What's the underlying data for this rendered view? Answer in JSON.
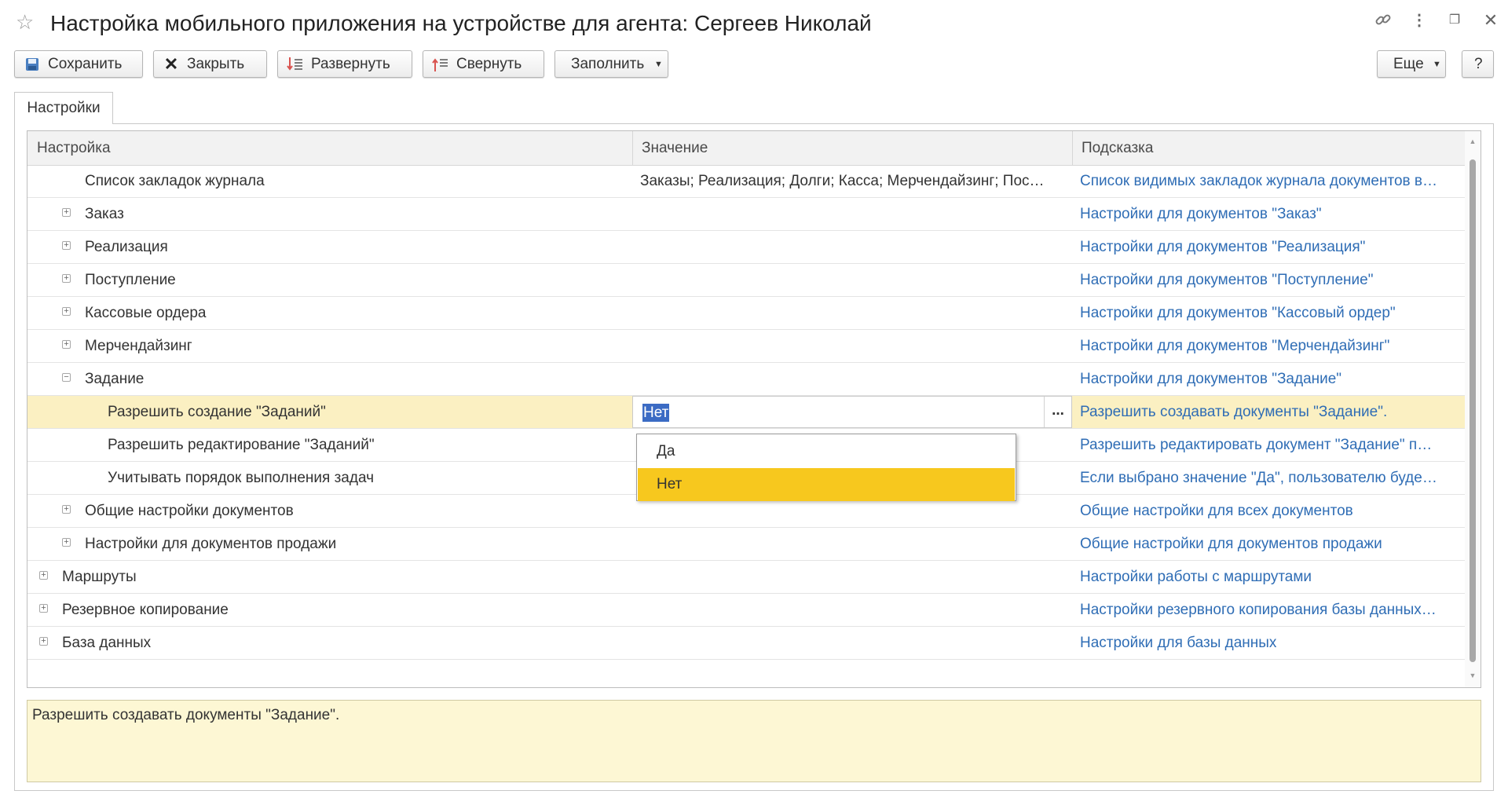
{
  "window": {
    "title": "Настройка мобильного приложения на устройстве для агента: Сергеев Николай",
    "controls": {
      "favorite_icon": "☆",
      "link_icon": "🔗",
      "more_icon": "⋮",
      "restore_icon": "❐",
      "close_icon": "✕"
    }
  },
  "toolbar": {
    "save_label": "Сохранить",
    "close_label": "Закрыть",
    "expand_label": "Развернуть",
    "collapse_label": "Свернуть",
    "fill_label": "Заполнить",
    "more_label": "Еще",
    "help_label": "?"
  },
  "tabs": [
    {
      "label": "Настройки",
      "active": true
    }
  ],
  "grid": {
    "columns": [
      "Настройка",
      "Значение",
      "Подсказка"
    ],
    "rows": [
      {
        "name": "Список закладок журнала",
        "value": "Заказы; Реализация; Долги; Касса; Мерчендайзинг; Пос…",
        "hint": "Список видимых закладок журнала документов в…",
        "toggle": "",
        "level": 1
      },
      {
        "name": "Заказ",
        "value": "",
        "hint": "Настройки для документов \"Заказ\"",
        "toggle": "+",
        "level": 1
      },
      {
        "name": "Реализация",
        "value": "",
        "hint": "Настройки для документов \"Реализация\"",
        "toggle": "+",
        "level": 1
      },
      {
        "name": "Поступление",
        "value": "",
        "hint": "Настройки для документов \"Поступление\"",
        "toggle": "+",
        "level": 1
      },
      {
        "name": "Кассовые ордера",
        "value": "",
        "hint": "Настройки для документов \"Кассовый ордер\"",
        "toggle": "+",
        "level": 1
      },
      {
        "name": "Мерчендайзинг",
        "value": "",
        "hint": "Настройки для документов \"Мерчендайзинг\"",
        "toggle": "+",
        "level": 1
      },
      {
        "name": "Задание",
        "value": "",
        "hint": "Настройки для документов \"Задание\"",
        "toggle": "−",
        "level": 1
      },
      {
        "name": "Разрешить создание \"Заданий\"",
        "value": "Нет",
        "hint": "Разрешить создавать документы \"Задание\".",
        "toggle": "",
        "level": 2,
        "selected": true
      },
      {
        "name": "Разрешить редактирование \"Заданий\"",
        "value": "",
        "hint": "Разрешить редактировать документ \"Задание\" п…",
        "toggle": "",
        "level": 2
      },
      {
        "name": "Учитывать порядок выполнения задач",
        "value": "",
        "hint": "Если выбрано значение \"Да\", пользователю буде…",
        "toggle": "",
        "level": 2
      },
      {
        "name": "Общие настройки документов",
        "value": "",
        "hint": "Общие настройки для всех документов",
        "toggle": "+",
        "level": 1
      },
      {
        "name": "Настройки для документов продажи",
        "value": "",
        "hint": "Общие настройки для документов продажи",
        "toggle": "+",
        "level": 1
      },
      {
        "name": "Маршруты",
        "value": "",
        "hint": "Настройки работы с маршрутами",
        "toggle": "+",
        "level": 0
      },
      {
        "name": "Резервное копирование",
        "value": "",
        "hint": "Настройки резервного копирования базы данных…",
        "toggle": "+",
        "level": 0
      },
      {
        "name": "База данных",
        "value": "",
        "hint": "Настройки для базы данных",
        "toggle": "+",
        "level": 0
      }
    ],
    "editor": {
      "value": "Нет",
      "choice_button": "..."
    },
    "dropdown": {
      "options": [
        "Да",
        "Нет"
      ],
      "selected": "Нет"
    }
  },
  "hint_panel": {
    "text": "Разрешить создавать документы \"Задание\"."
  },
  "colors": {
    "accent_link": "#2f6db5",
    "selected_row": "#fbf0c2",
    "dropdown_active": "#f7c81e",
    "hint_bg": "#fdf7d4"
  }
}
